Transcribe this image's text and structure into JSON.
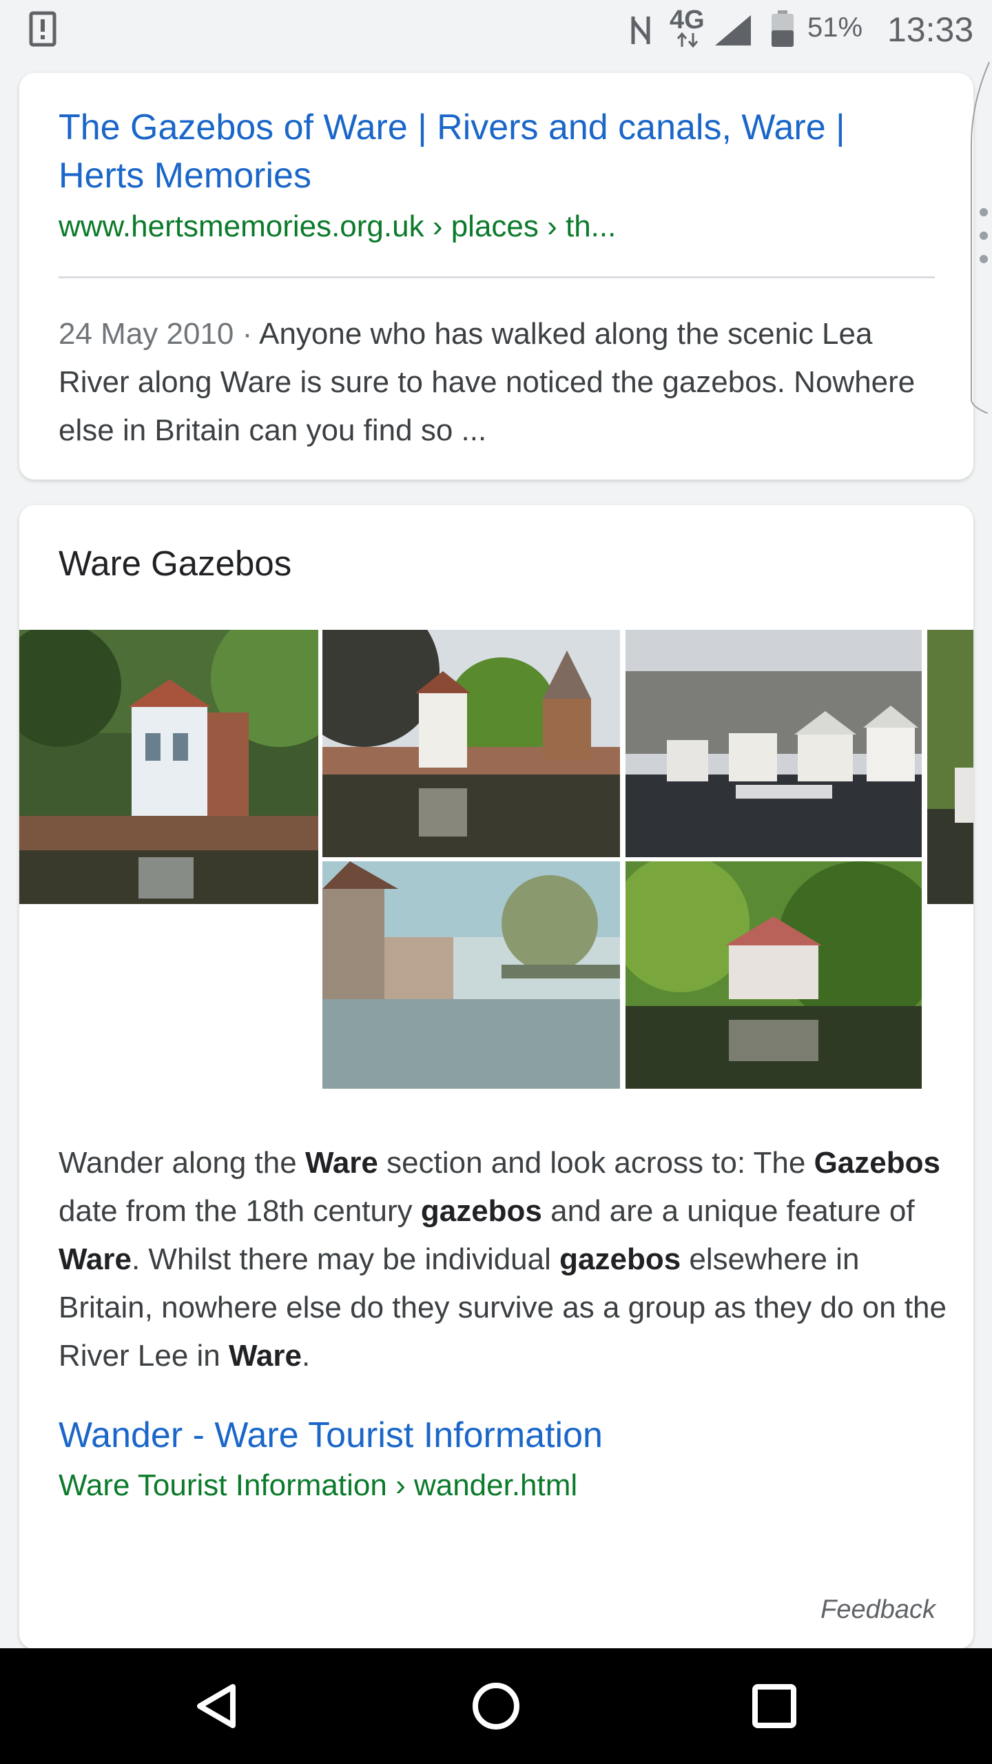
{
  "status_bar": {
    "network": "4G",
    "battery": "51%",
    "time": "13:33"
  },
  "result": {
    "title": "The Gazebos of Ware | Rivers and canals, Ware | Herts Memories",
    "url": "www.hertsmemories.org.uk › places › th...",
    "date": "24 May 2010",
    "snippet": "Anyone who has walked along the scenic Lea River along Ware is sure to have noticed the gazebos. Nowhere else in Britain can you find so  ..."
  },
  "knowledge": {
    "heading": "Ware Gazebos",
    "description": [
      {
        "t": "Wander along the ",
        "b": false
      },
      {
        "t": "Ware",
        "b": true
      },
      {
        "t": " section and look across to: The ",
        "b": false
      },
      {
        "t": "Gazebos",
        "b": true
      },
      {
        "t": " date from the 18th century ",
        "b": false
      },
      {
        "t": "gazebos",
        "b": true
      },
      {
        "t": " and are a unique feature of ",
        "b": false
      },
      {
        "t": "Ware",
        "b": true
      },
      {
        "t": ". Whilst there may be individual ",
        "b": false
      },
      {
        "t": "gazebos",
        "b": true
      },
      {
        "t": " elsewhere in Britain, nowhere else do they survive as a group as they do on the River Lee in ",
        "b": false
      },
      {
        "t": "Ware",
        "b": true
      },
      {
        "t": ".",
        "b": false
      }
    ],
    "source_title": "Wander - Ware Tourist Information",
    "source_url": "Ware Tourist Information › wander.html",
    "feedback": "Feedback"
  },
  "colors": {
    "link": "#1a66c9",
    "url": "#0b7a2a",
    "text": "#3c4043"
  },
  "icons": {
    "status": [
      "alert-icon",
      "nfc-icon",
      "signal-icon",
      "battery-icon"
    ],
    "nav": [
      "back-icon",
      "home-icon",
      "recents-icon"
    ]
  }
}
